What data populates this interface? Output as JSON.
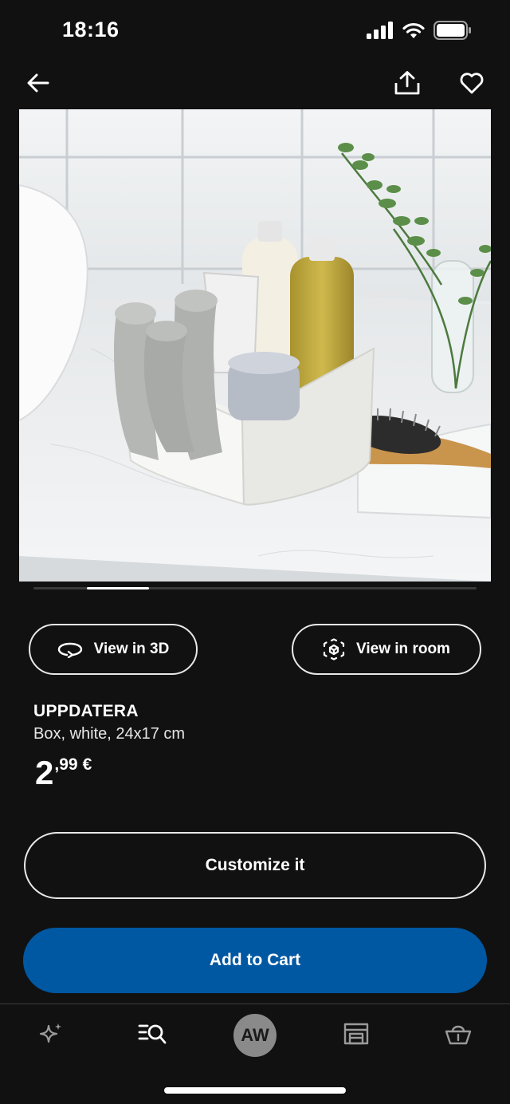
{
  "status_bar": {
    "time": "18:16",
    "icons": [
      "cellular-signal-icon",
      "wifi-icon",
      "battery-icon"
    ]
  },
  "nav": {
    "icons": [
      "back-arrow-icon",
      "share-icon",
      "heart-icon"
    ]
  },
  "product_image": {
    "carousel_progress": 0.14
  },
  "view_buttons": {
    "view_3d_label": "View in 3D",
    "view_room_label": "View in room"
  },
  "product": {
    "name": "UPPDATERA",
    "description": "Box, white, 24x17 cm",
    "price_integer": "2",
    "price_decimal": ",99",
    "price_currency": "€"
  },
  "actions": {
    "customize_label": "Customize it",
    "add_to_cart_label": "Add to Cart"
  },
  "tab_bar": {
    "avatar_initials": "AW",
    "icons": [
      "sparkle-icon",
      "search-list-icon",
      "avatar",
      "store-icon",
      "basket-icon"
    ]
  },
  "colors": {
    "background": "#111111",
    "accent_blue": "#0058a3",
    "text": "#ffffff"
  }
}
